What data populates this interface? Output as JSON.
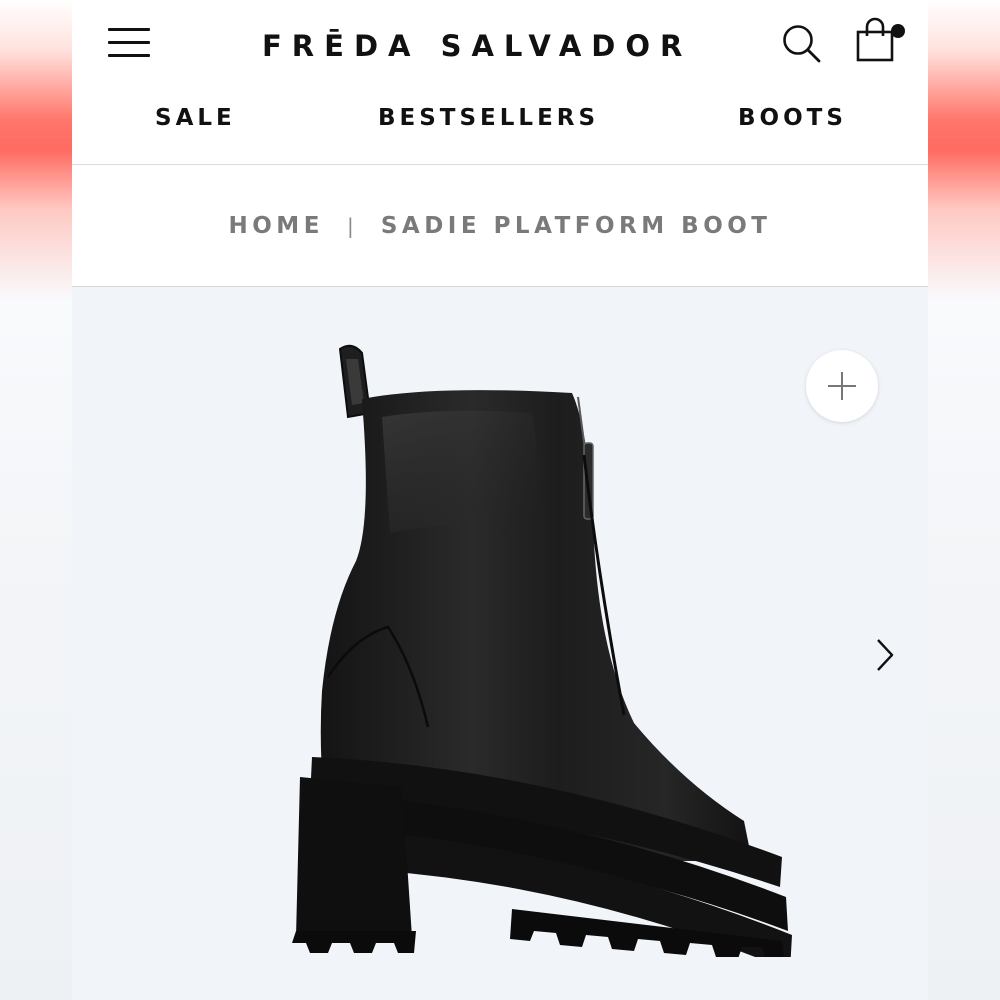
{
  "brand": {
    "logo_text": "FRĒDA SALVADOR"
  },
  "header": {
    "menu_icon": "hamburger-menu-icon",
    "search_icon": "search-icon",
    "cart_icon": "shopping-bag-icon",
    "cart_has_items": true
  },
  "nav": {
    "items": [
      {
        "label": "SALE"
      },
      {
        "label": "BESTSELLERS"
      },
      {
        "label": "BOOTS"
      }
    ]
  },
  "breadcrumb": {
    "home": "HOME",
    "separator": "|",
    "current": "SADIE PLATFORM BOOT"
  },
  "gallery": {
    "zoom_icon": "plus-icon",
    "next_icon": "chevron-right-icon",
    "image_subject": "black leather platform boot"
  },
  "colors": {
    "text_primary": "#111111",
    "breadcrumb_text": "#7a7a7a",
    "gallery_bg": "#f1f4f9",
    "boot": "#1b1b1b"
  }
}
